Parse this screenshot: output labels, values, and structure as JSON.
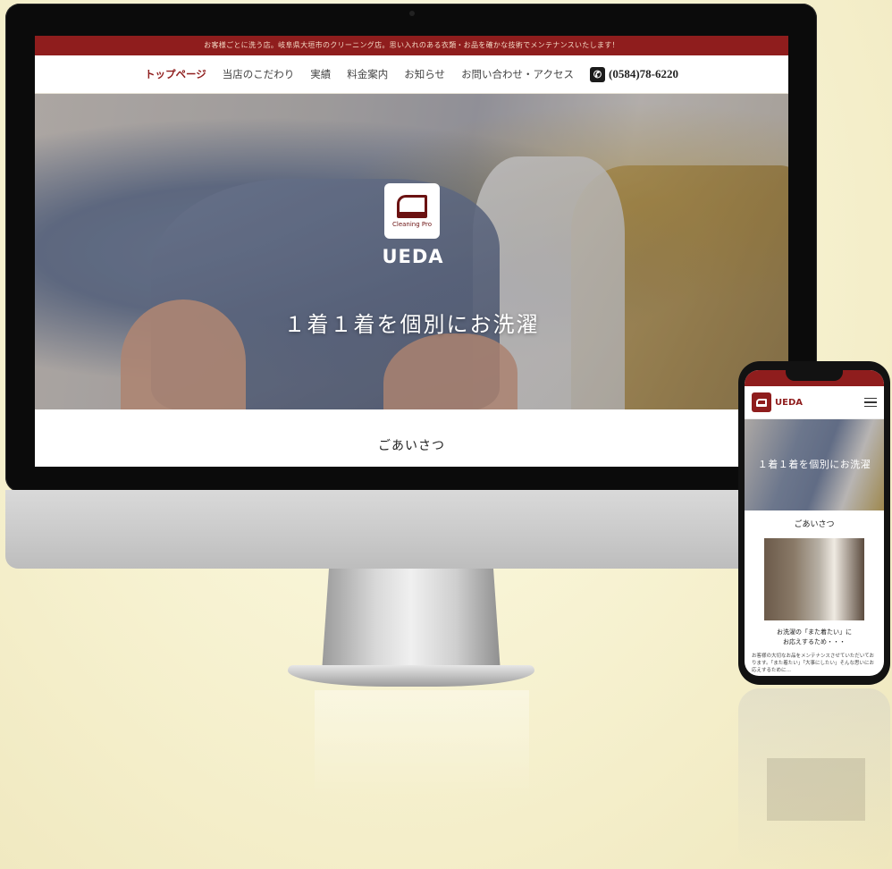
{
  "desktop": {
    "announcement": "お客様ごとに洗う店。岐阜県大垣市のクリーニング店。思い入れのある衣類・お品を確かな技術でメンテナンスいたします！",
    "nav": [
      {
        "label": "トップページ",
        "active": true
      },
      {
        "label": "当店のこだわり",
        "active": false
      },
      {
        "label": "実績",
        "active": false
      },
      {
        "label": "料金案内",
        "active": false
      },
      {
        "label": "お知らせ",
        "active": false
      },
      {
        "label": "お問い合わせ・アクセス",
        "active": false
      }
    ],
    "phone_number": "(0584)78-6220",
    "phone_icon": "phone-icon",
    "logo_caption": "Cleaning Pro",
    "brand": "UEDA",
    "tagline": "１着１着を個別にお洗濯",
    "greeting_title": "ごあいさつ"
  },
  "mobile": {
    "brand": "UEDA",
    "menu_icon": "hamburger-icon",
    "tagline": "１着１着を個別にお洗濯",
    "greeting_title": "ごあいさつ",
    "catch_line1": "お洗濯の「また着たい」に",
    "catch_line2": "お応えするため・・・",
    "body_text": "お客様の大切なお品をメンテナンスさせていただいております。「また着たい」「大事にしたい」そんな思いにお応えするために…"
  },
  "colors": {
    "accent": "#8f1d1d",
    "background": "#f6f1cf"
  }
}
